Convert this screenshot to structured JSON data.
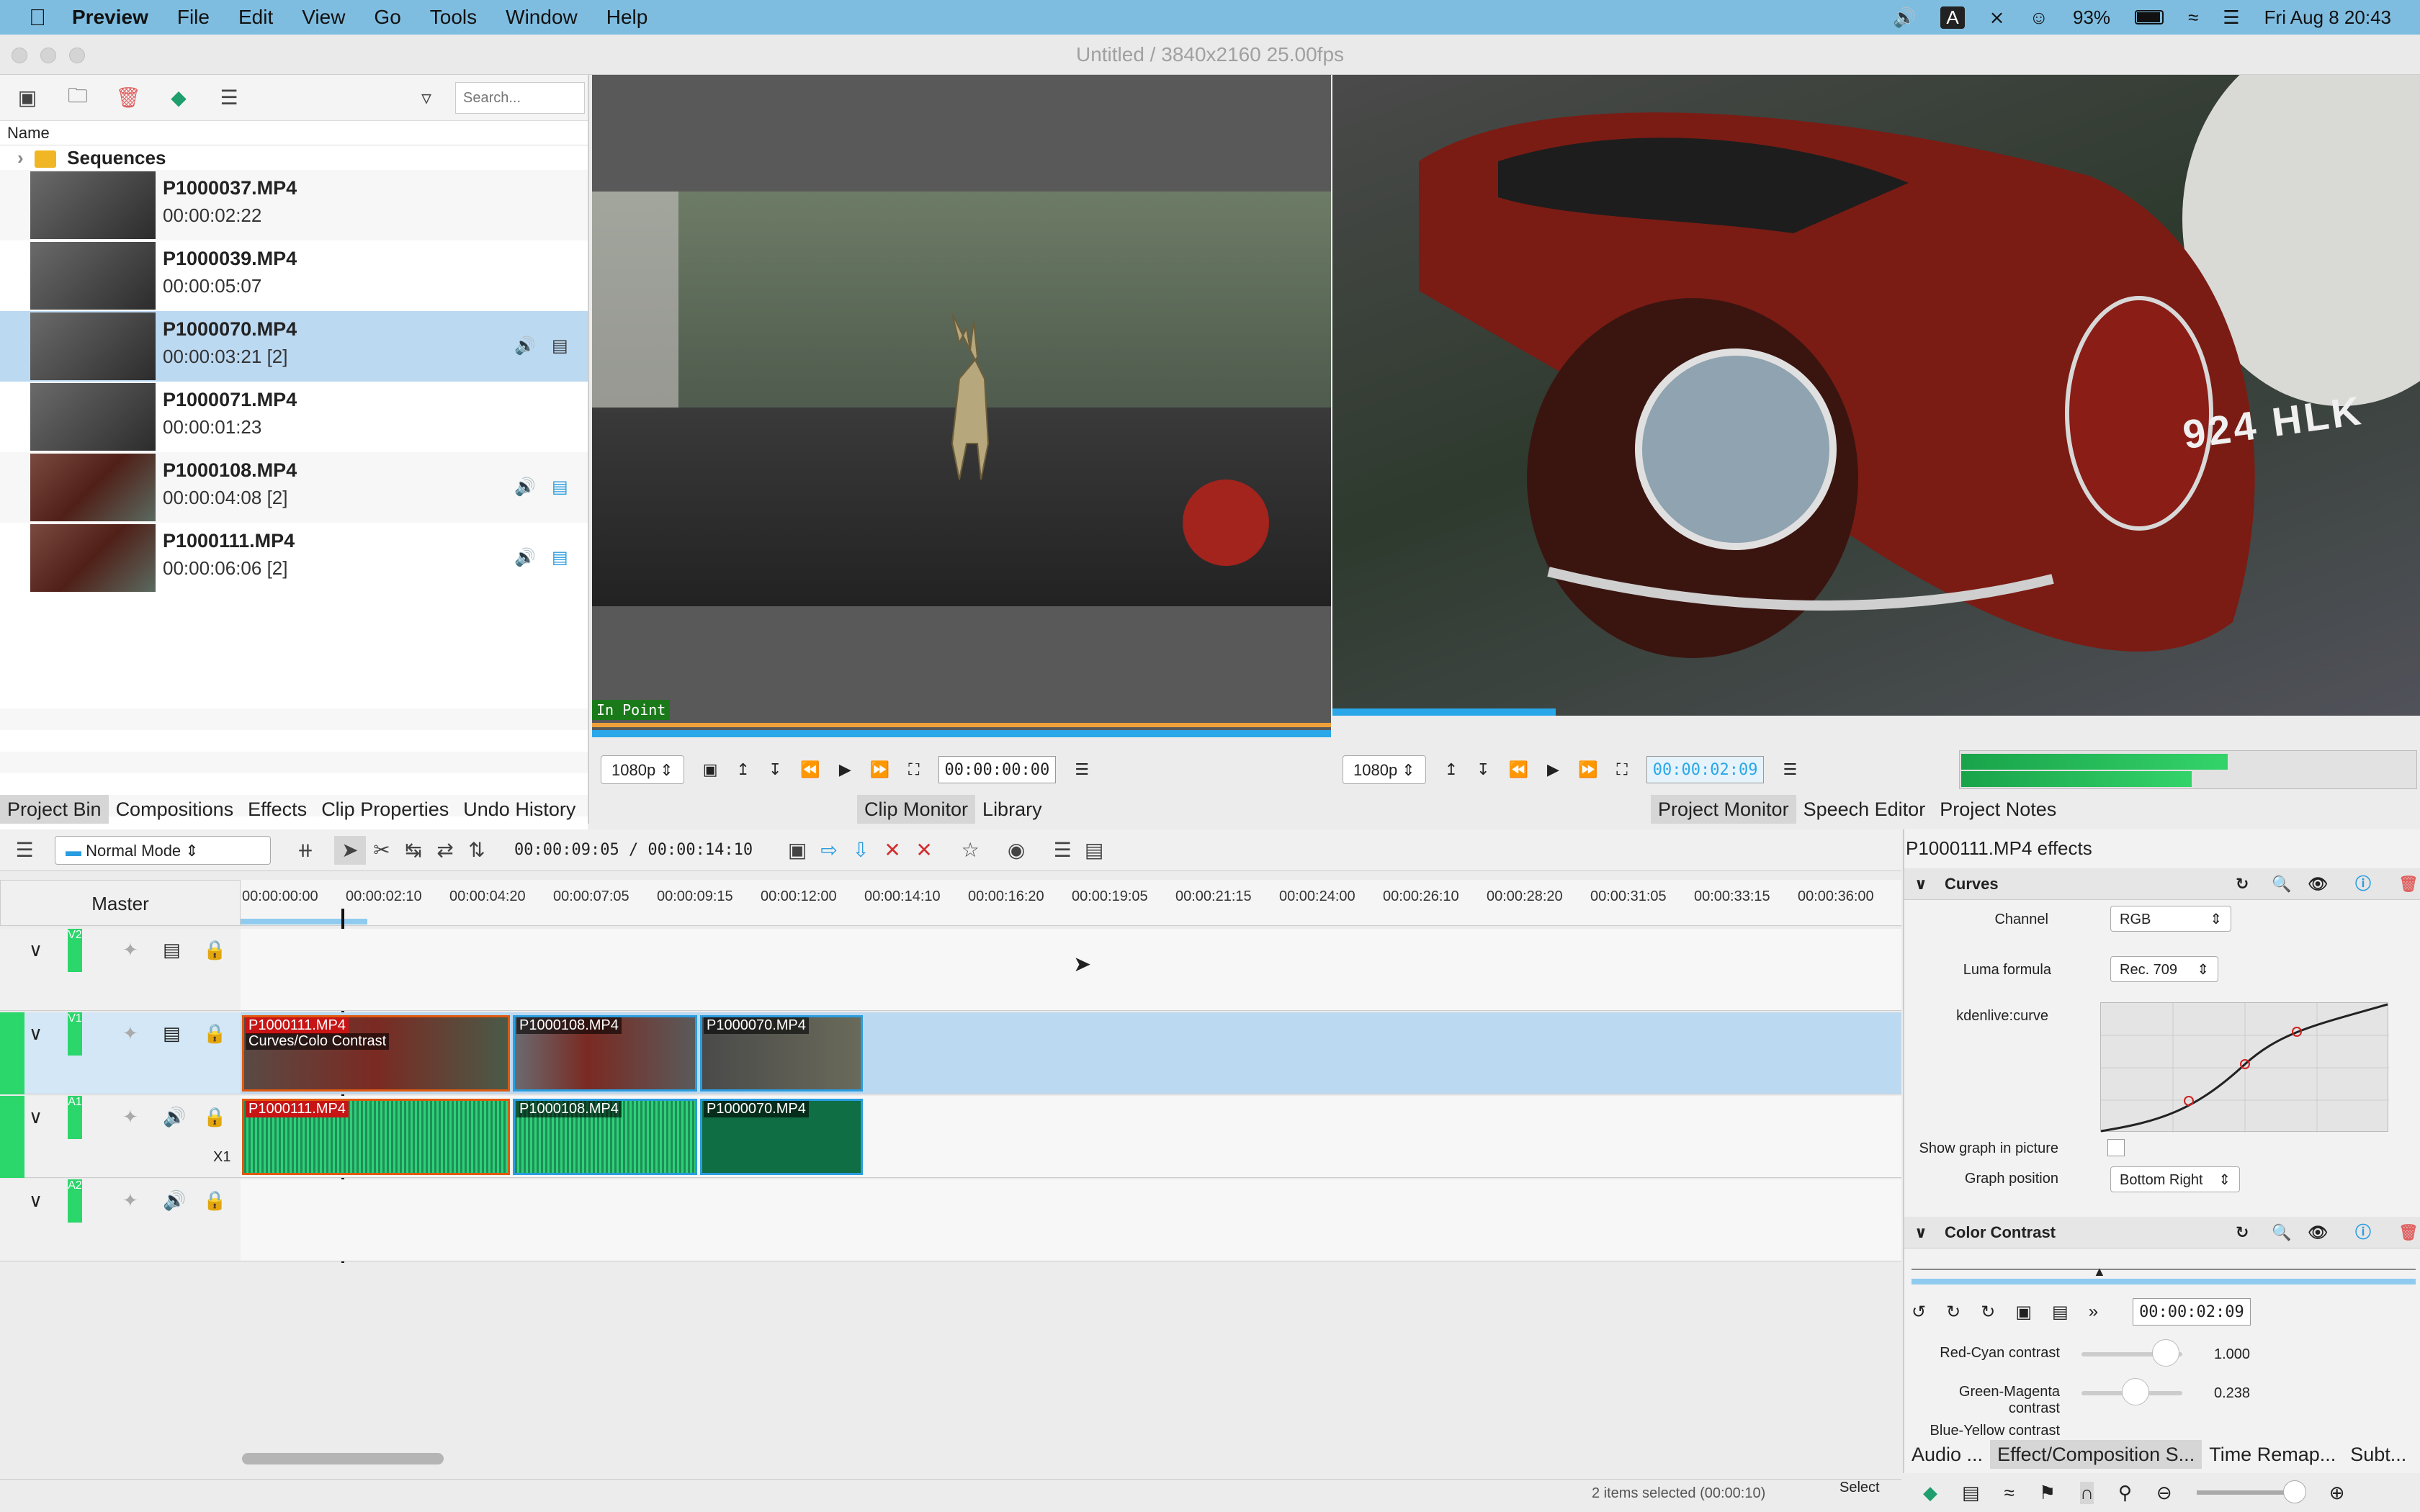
{
  "menubar": {
    "items": [
      "Preview",
      "File",
      "Edit",
      "View",
      "Go",
      "Tools",
      "Window",
      "Help"
    ],
    "battery": "93%",
    "datetime": "Fri Aug 8  20:43",
    "input_source": "A"
  },
  "window": {
    "title": "Untitled / 3840x2160 25.00fps"
  },
  "bin": {
    "search_placeholder": "Search...",
    "column_name": "Name",
    "folder": "Sequences",
    "clips": [
      {
        "name": "P1000037.MP4",
        "duration": "00:00:02:22"
      },
      {
        "name": "P1000039.MP4",
        "duration": "00:00:05:07"
      },
      {
        "name": "P1000070.MP4",
        "duration": "00:00:03:21 [2]"
      },
      {
        "name": "P1000071.MP4",
        "duration": "00:00:01:23"
      },
      {
        "name": "P1000108.MP4",
        "duration": "00:00:04:08 [2]"
      },
      {
        "name": "P1000111.MP4",
        "duration": "00:00:06:06 [2]"
      }
    ],
    "tabs": [
      "Project Bin",
      "Compositions",
      "Effects",
      "Clip Properties",
      "Undo History"
    ]
  },
  "clip_monitor": {
    "in_point_label": "In Point",
    "resolution": "1080p",
    "timecode": "00:00:00:00",
    "tabs": [
      "Clip Monitor",
      "Library"
    ]
  },
  "project_monitor": {
    "resolution": "1080p",
    "timecode": "00:00:02:09",
    "plate": "924 HLK",
    "tabs": [
      "Project Monitor",
      "Speech Editor",
      "Project Notes"
    ]
  },
  "timeline": {
    "mode": "Normal Mode",
    "position": "00:00:09:05 / 00:00:14:10",
    "master_label": "Master",
    "ruler": [
      "00:00:00:00",
      "00:00:02:10",
      "00:00:04:20",
      "00:00:07:05",
      "00:00:09:15",
      "00:00:12:00",
      "00:00:14:10",
      "00:00:16:20",
      "00:00:19:05",
      "00:00:21:15",
      "00:00:24:00",
      "00:00:26:10",
      "00:00:28:20",
      "00:00:31:05",
      "00:00:33:15",
      "00:00:36:00"
    ],
    "tracks": [
      "V2",
      "V1",
      "A1",
      "A2"
    ],
    "a1_extra": "X1",
    "v1_clips": [
      "P1000111.MP4",
      "P1000108.MP4",
      "P1000070.MP4"
    ],
    "v1_effect_label": "Curves/Colo  Contrast",
    "a1_clips": [
      "P1000111.MP4",
      "P1000108.MP4",
      "P1000070.MP4"
    ]
  },
  "effects_panel": {
    "title": "P1000111.MP4 effects",
    "curves": {
      "name": "Curves",
      "channel_label": "Channel",
      "channel_value": "RGB",
      "luma_label": "Luma formula",
      "luma_value": "Rec. 709",
      "curve_label": "kdenlive:curve",
      "show_graph_label": "Show graph in picture",
      "graph_pos_label": "Graph position",
      "graph_pos_value": "Bottom Right"
    },
    "contrast": {
      "name": "Color Contrast",
      "timecode": "00:00:02:09",
      "params": [
        {
          "label": "Red-Cyan contrast",
          "value": "1.000"
        },
        {
          "label": "Green-Magenta contrast",
          "value": "0.238"
        },
        {
          "label": "Blue-Yellow contrast",
          "value": ""
        }
      ]
    },
    "tabs": [
      "Audio ...",
      "Effect/Composition S...",
      "Time Remap...",
      "Subt..."
    ]
  },
  "status": {
    "selected": "2 items selected (00:00:10)",
    "tool": "Select"
  }
}
